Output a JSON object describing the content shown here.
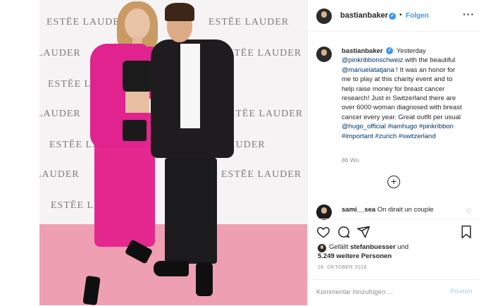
{
  "post": {
    "photo": {
      "logo_text": [
        "ESTĒE LAUDER",
        "ESTĒE LAUDER",
        "LAUDER",
        "ESTĒE LA",
        "ESTĒE LAUDER",
        "ESTĒE LAUDER",
        "LAUDER",
        "ESTĒE LAUDER",
        "LAUDER",
        "ESTĒE LAUDER",
        "ESTĒE LAUDER",
        "LAUDER"
      ]
    },
    "header": {
      "username": "bastianbaker",
      "separator": "•",
      "follow_label": "Folgen",
      "more_label": "···"
    },
    "caption": {
      "username": "bastianbaker",
      "time": "Yesterday",
      "mention1": "@pinkribbonschweiz",
      "text1": " with the beautiful ",
      "mention2": "@manuelatatjana",
      "text2": " ! It was an honor for me to play at this charity event and to help raise money for breast cancer research! Just in Switzerland there are over 6000 woman diagnosed with breast cancer every year. Great outfit per usual ",
      "mention3": "@hugo_official",
      "text3": " ",
      "hashtag1": "#iamhugo",
      "text4": " ",
      "hashtag2": "#pinkribbon",
      "text5": " ",
      "hashtag3": "#important",
      "text6": " ",
      "hashtag4": "#zurich",
      "text7": " ",
      "hashtag5": "#switzerland",
      "age": "86 Wo."
    },
    "comment": {
      "username": "sami__sea",
      "text": "On dirait un couple"
    },
    "likes": {
      "prefix": "Gefällt ",
      "user": "stefanbuesser",
      "middle": " und",
      "count": "5.249 weitere Personen"
    },
    "date": "28. OKTOBER 2018",
    "comment_box": {
      "placeholder": "Kommentar hinzufügen ...",
      "post_label": "Posten"
    }
  },
  "colors": {
    "accent": "#3897f0",
    "link": "#003569",
    "pink_jacket": "#e0238f",
    "floor": "#ee9fb2"
  },
  "icons": [
    "heart-icon",
    "comment-icon",
    "share-icon",
    "bookmark-icon",
    "add-comment-icon",
    "verified-badge-icon",
    "more-options-icon"
  ]
}
